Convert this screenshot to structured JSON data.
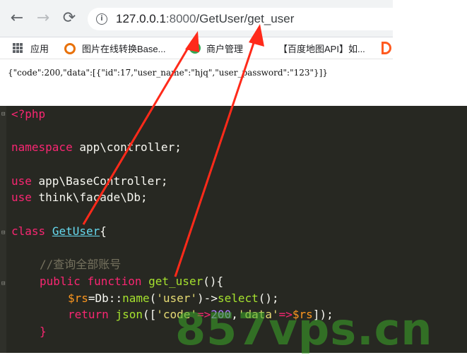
{
  "browser": {
    "back_glyph": "←",
    "forward_glyph": "→",
    "reload_glyph": "⟳",
    "url_host": "127.0.0.1",
    "url_port": ":8000",
    "url_path": "/GetUser/get_user",
    "bookmarks": {
      "apps": "应用",
      "item1": "图片在线转换Base...",
      "item2": "商户管理",
      "item3": "【百度地图API】如..."
    }
  },
  "response": {
    "json_text": "{\"code\":200,\"data\":[{\"id\":17,\"user_name\":\"hjq\",\"user_password\":\"123\"}]}"
  },
  "code": {
    "l1": "<?php",
    "l2_kw": "namespace",
    "l2_rest": " app\\controller;",
    "l3_kw": "use",
    "l3_rest": " app\\BaseController;",
    "l4_kw": "use",
    "l4_rest": " think\\facade\\Db;",
    "l5_kw": "class",
    "l5_cls": "GetUser",
    "l5_brace": "{",
    "l6_cmt": "//查询全部账号",
    "l7_kw1": "public",
    "l7_kw2": "function",
    "l7_fn": "get_user",
    "l7_rest": "(){",
    "l8_var": "$rs",
    "l8_eq": "=Db::",
    "l8_fn": "name",
    "l8_p1": "(",
    "l8_str": "'user'",
    "l8_p2": ")->",
    "l8_fn2": "select",
    "l8_p3": "();",
    "l9_kw": "return",
    "l9_fn": "json",
    "l9_p1": "([",
    "l9_str1": "'code'",
    "l9_arrow1": "=>",
    "l9_num": "200",
    "l9_comma": ",",
    "l9_str2": "'data'",
    "l9_arrow2": "=>",
    "l9_var": "$rs",
    "l9_end": "]);",
    "l10": "}"
  },
  "watermark": "857vps.cn",
  "colors": {
    "editor_bg": "#272822",
    "arrow": "#ff2a1a",
    "watermark": "#3caa28"
  }
}
